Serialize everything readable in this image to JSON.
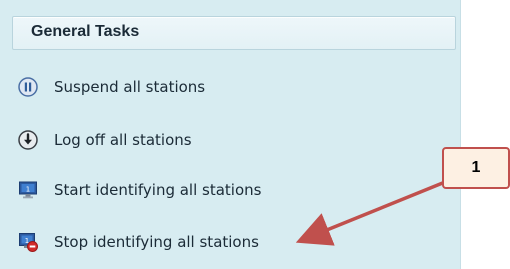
{
  "panel": {
    "title": "General Tasks",
    "tasks": [
      {
        "label": "Suspend all stations",
        "icon": "pause-icon"
      },
      {
        "label": "Log off all stations",
        "icon": "logoff-icon"
      },
      {
        "label": "Start identifying all stations",
        "icon": "monitor-identify-icon"
      },
      {
        "label": "Stop identifying all stations",
        "icon": "monitor-stop-icon"
      }
    ]
  },
  "annotation": {
    "callout_text": "1",
    "color": "#c0504d"
  },
  "colors": {
    "panel_bg": "#d7ecf1",
    "header_bg": "#e3f1f5"
  }
}
